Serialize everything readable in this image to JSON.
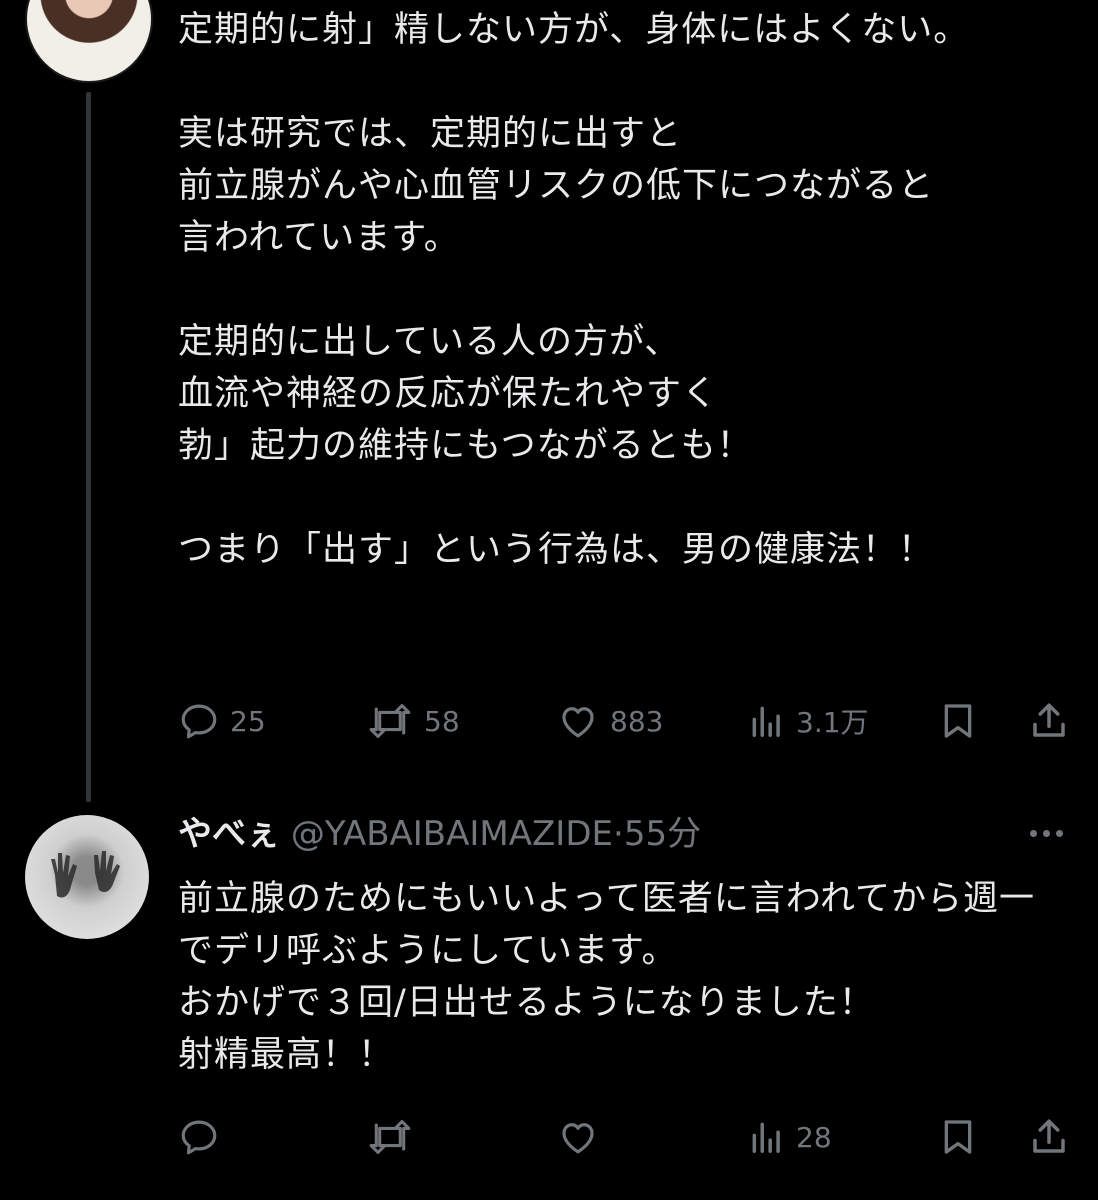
{
  "post": {
    "text": "定期的に射」精しない方が、身体にはよくない。\n\n実は研究では、定期的に出すと\n前立腺がんや心血管リスクの低下につながると\n言われています。\n\n定期的に出している人の方が、\n血流や神経の反応が保たれやすく\n勃」起力の維持にもつながるとも！\n\nつまり「出す」という行為は、男の健康法！！",
    "replies": "25",
    "reposts": "58",
    "likes": "883",
    "views": "3.1万"
  },
  "reply": {
    "name": "やべぇ",
    "handle": "@YABAIBAIMAZIDE",
    "separator": "·",
    "time": "55分",
    "text": "前立腺のためにもいいよって医者に言われてから週一でデリ呼ぶようにしています。\nおかげで３回/日出せるようになりました！\n射精最高！！",
    "views": "28"
  },
  "icons": {
    "reply": "reply-icon",
    "repost": "repost-icon",
    "like": "like-icon",
    "views": "views-icon",
    "bookmark": "bookmark-icon",
    "share": "share-icon",
    "more": "more-icon"
  }
}
